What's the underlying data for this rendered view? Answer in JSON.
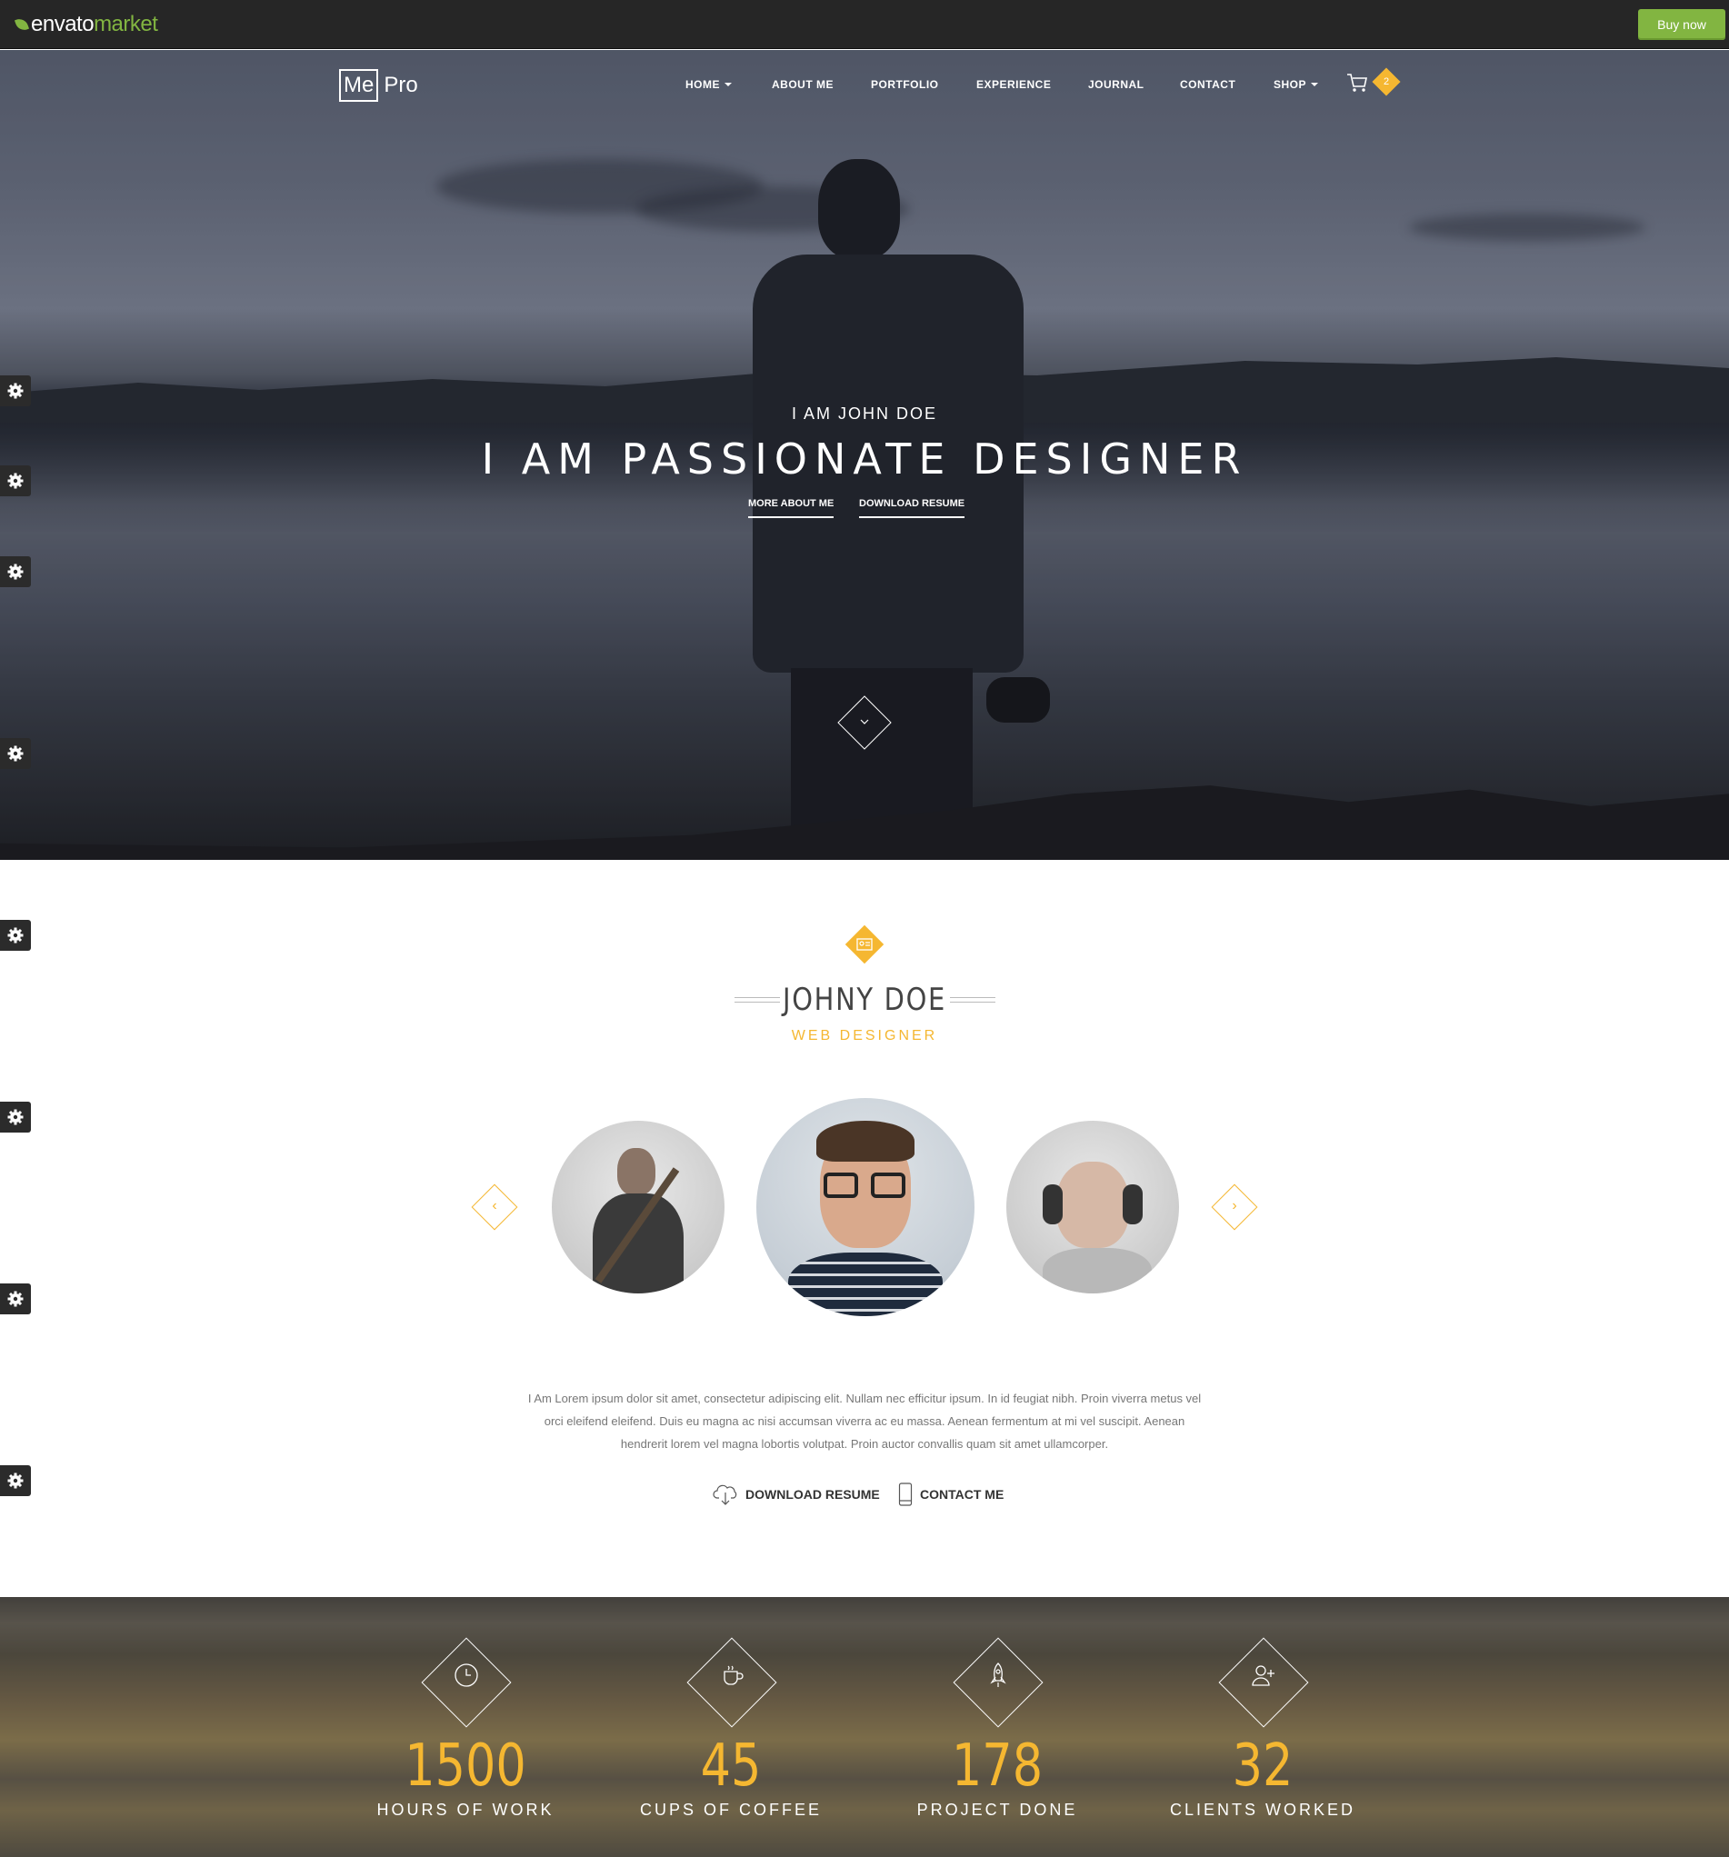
{
  "envato": {
    "brand": "envato",
    "market": "market",
    "buy_now": "Buy now"
  },
  "header": {
    "logo_me": "Me",
    "logo_pro": "Pro",
    "nav": [
      "HOME",
      "ABOUT ME",
      "PORTFOLIO",
      "EXPERIENCE",
      "JOURNAL",
      "CONTACT",
      "SHOP"
    ],
    "cart_count": "2"
  },
  "hero": {
    "subtitle": "I AM JOHN DOE",
    "title": "I AM PASSIONATE DESIGNER",
    "btn_more": "MORE ABOUT ME",
    "btn_resume": "DOWNLOAD RESUME"
  },
  "about": {
    "name": "JOHNY DOE",
    "role": "WEB DESIGNER",
    "bio": "I Am Lorem ipsum dolor sit amet, consectetur adipiscing elit. Nullam nec efficitur ipsum. In id feugiat nibh. Proin viverra metus vel orci eleifend eleifend. Duis eu magna ac nisi accumsan viverra ac eu massa. Aenean fermentum at mi vel suscipit. Aenean hendrerit lorem vel magna lobortis volutpat. Proin auctor convallis quam sit amet ullamcorper.",
    "download_resume": "DOWNLOAD RESUME",
    "contact_me": "CONTACT ME",
    "prev_arrow": "‹",
    "next_arrow": "›"
  },
  "stats": [
    {
      "value": "1500",
      "label": "HOURS OF WORK",
      "icon": "clock-icon"
    },
    {
      "value": "45",
      "label": "CUPS OF COFFEE",
      "icon": "coffee-icon"
    },
    {
      "value": "178",
      "label": "PROJECT DONE",
      "icon": "rocket-icon"
    },
    {
      "value": "32",
      "label": "CLIENTS WORKED",
      "icon": "add-user-icon"
    }
  ],
  "colors": {
    "accent": "#f5b731",
    "envato_green": "#82b541",
    "dark_bar": "#262626"
  }
}
